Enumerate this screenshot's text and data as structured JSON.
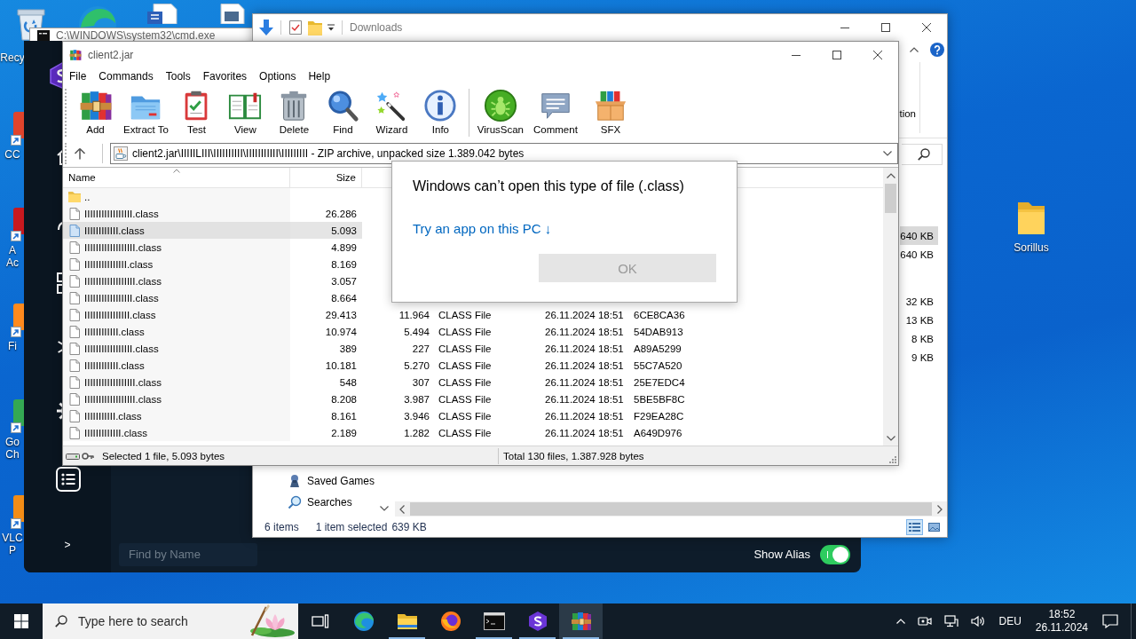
{
  "desktop": {
    "icons": [
      {
        "kind": "recycle-bin",
        "lines": [
          "Recy"
        ]
      },
      {
        "kind": "shortcut",
        "color": "#e0442c",
        "lines": [
          "CC"
        ]
      },
      {
        "kind": "shortcut",
        "color": "#c8191f",
        "lines": [
          "A",
          "Ac"
        ]
      },
      {
        "kind": "shortcut",
        "color": "#ff8a1e",
        "lines": [
          "Fi"
        ]
      },
      {
        "kind": "shortcut",
        "color": "#34a853",
        "lines": [
          "Go",
          "Ch"
        ]
      },
      {
        "kind": "shortcut",
        "color": "#f28c16",
        "lines": [
          "VLC",
          "P"
        ]
      }
    ],
    "folder": {
      "label": "Sorillus"
    }
  },
  "console": {
    "title": "C:\\WINDOWS\\system32\\cmd.exe"
  },
  "dark_app": {
    "expand": ">",
    "search": {
      "placeholder": "Find by Name"
    },
    "alias_toggle": {
      "label": "Show Alias",
      "on": true
    }
  },
  "explorer": {
    "title": "Downloads",
    "ribbon_label": "tion",
    "file_groups": [
      {
        "rows": [
          {
            "size": "640 KB",
            "selected": true
          },
          {
            "size": "640 KB",
            "selected": false
          }
        ]
      },
      {
        "rows": [
          {
            "size": "32 KB",
            "selected": false
          },
          {
            "size": "13 KB",
            "selected": false
          },
          {
            "size": "8 KB",
            "selected": false
          },
          {
            "size": "9 KB",
            "selected": false
          }
        ]
      }
    ],
    "nav_items": [
      {
        "kind": "game",
        "label": "Saved Games"
      },
      {
        "kind": "search",
        "label": "Searches"
      }
    ],
    "status": {
      "count": "6 items",
      "selection": "1 item selected",
      "size": "639 KB"
    },
    "views": [
      {
        "kind": "details",
        "selected": true
      },
      {
        "kind": "tiles",
        "selected": false
      }
    ]
  },
  "archive_manager": {
    "title": "client2.jar",
    "menu": [
      "File",
      "Commands",
      "Tools",
      "Favorites",
      "Options",
      "Help"
    ],
    "toolbar": [
      {
        "buttons": [
          {
            "kind": "add",
            "label": "Add"
          },
          {
            "kind": "extract",
            "label": "Extract To"
          },
          {
            "kind": "test",
            "label": "Test"
          },
          {
            "kind": "view",
            "label": "View"
          },
          {
            "kind": "delete",
            "label": "Delete"
          },
          {
            "kind": "find",
            "label": "Find"
          },
          {
            "kind": "wizard",
            "label": "Wizard"
          },
          {
            "kind": "info",
            "label": "Info"
          }
        ]
      },
      {
        "buttons": [
          {
            "kind": "scan",
            "label": "VirusScan"
          },
          {
            "kind": "comment",
            "label": "Comment"
          },
          {
            "kind": "sfx",
            "label": "SFX"
          }
        ]
      }
    ],
    "path": "client2.jar\\IIIIILIII\\IIIIIIIIII\\IIIIIIIIIII\\IIIIIIIII - ZIP archive, unpacked size 1.389.042 bytes",
    "columns": [
      {
        "label": "Name",
        "sorted": true
      },
      {
        "label": "Size",
        "sorted": false
      }
    ],
    "rows": [
      {
        "kind": "parent",
        "name": "..",
        "selected": false
      },
      {
        "kind": "file",
        "name": "IIIIIIIIIIIIIIIII.class",
        "size": "26.286",
        "selected": false
      },
      {
        "kind": "file",
        "name": "IIIIIIIIIIII.class",
        "size": "5.093",
        "selected": true
      },
      {
        "kind": "file",
        "name": "IIIIIIIIIIIIIIIIII.class",
        "size": "4.899",
        "selected": false
      },
      {
        "kind": "file",
        "name": "IIIIIIIIIIIIIII.class",
        "size": "8.169",
        "selected": false
      },
      {
        "kind": "file",
        "name": "IIIIIIIIIIIIIIIIII.class",
        "size": "3.057",
        "selected": false
      },
      {
        "kind": "file",
        "name": "IIIIIIIIIIIIIIIII.class",
        "size": "8.664",
        "selected": false
      },
      {
        "kind": "file",
        "name": "IIIIIIIIIIIIIIII.class",
        "size": "29.413",
        "packed": "11.964",
        "type": "CLASS File",
        "modified": "26.11.2024 18:51",
        "crc": "6CE8CA36",
        "selected": false
      },
      {
        "kind": "file",
        "name": "IIIIIIIIIIII.class",
        "size": "10.974",
        "packed": "5.494",
        "type": "CLASS File",
        "modified": "26.11.2024 18:51",
        "crc": "54DAB913",
        "selected": false
      },
      {
        "kind": "file",
        "name": "IIIIIIIIIIIIIIIII.class",
        "size": "389",
        "packed": "227",
        "type": "CLASS File",
        "modified": "26.11.2024 18:51",
        "crc": "A89A5299",
        "selected": false
      },
      {
        "kind": "file",
        "name": "IIIIIIIIIIII.class",
        "size": "10.181",
        "packed": "5.270",
        "type": "CLASS File",
        "modified": "26.11.2024 18:51",
        "crc": "55C7A520",
        "selected": false
      },
      {
        "kind": "file",
        "name": "IIIIIIIIIIIIIIIIII.class",
        "size": "548",
        "packed": "307",
        "type": "CLASS File",
        "modified": "26.11.2024 18:51",
        "crc": "25E7EDC4",
        "selected": false
      },
      {
        "kind": "file",
        "name": "IIIIIIIIIIIIIIIIII.class",
        "size": "8.208",
        "packed": "3.987",
        "type": "CLASS File",
        "modified": "26.11.2024 18:51",
        "crc": "5BE5BF8C",
        "selected": false
      },
      {
        "kind": "file",
        "name": "IIIIIIIIIII.class",
        "size": "8.161",
        "packed": "3.946",
        "type": "CLASS File",
        "modified": "26.11.2024 18:51",
        "crc": "F29EA28C",
        "selected": false
      },
      {
        "kind": "file",
        "name": "IIIIIIIIIIIII.class",
        "size": "2.189",
        "packed": "1.282",
        "type": "CLASS File",
        "modified": "26.11.2024 18:51",
        "crc": "A649D976",
        "selected": false
      }
    ],
    "status": {
      "selection": "Selected 1 file, 5.093 bytes",
      "total": "Total 130 files, 1.387.928 bytes"
    }
  },
  "dialog": {
    "title": "Windows can’t open this type of file (.class)",
    "link": "Try an app on this PC ↓",
    "button": {
      "label": "OK",
      "disabled": true
    }
  },
  "taskbar": {
    "search": {
      "placeholder": "Type here to search"
    },
    "apps": [
      {
        "kind": "task-view",
        "running": false,
        "selected": false
      },
      {
        "kind": "swirl",
        "running": false,
        "selected": false
      },
      {
        "kind": "folder",
        "running": true,
        "selected": false
      },
      {
        "kind": "flame-globe",
        "running": false,
        "selected": false
      },
      {
        "kind": "terminal",
        "running": true,
        "selected": false
      },
      {
        "kind": "hexagon",
        "running": true,
        "selected": false
      },
      {
        "kind": "archive",
        "running": true,
        "selected": true
      }
    ],
    "tray": {
      "language": "DEU",
      "time": "18:52",
      "date": "26.11.2024"
    }
  }
}
